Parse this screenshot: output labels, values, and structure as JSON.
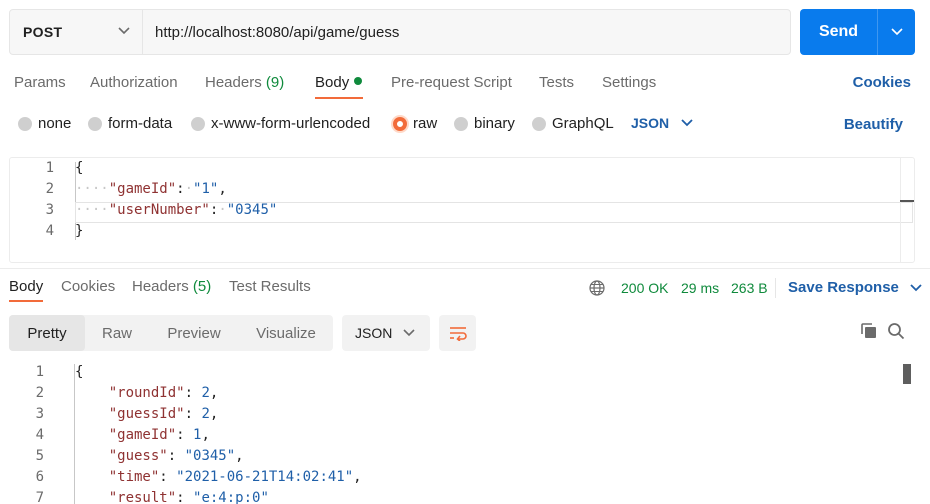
{
  "request": {
    "method": "POST",
    "url": "http://localhost:8080/api/game/guess",
    "send_label": "Send"
  },
  "request_tabs": [
    {
      "label": "Params"
    },
    {
      "label": "Authorization"
    },
    {
      "label": "Headers",
      "count": "(9)"
    },
    {
      "label": "Body"
    },
    {
      "label": "Pre-request Script"
    },
    {
      "label": "Tests"
    },
    {
      "label": "Settings"
    }
  ],
  "cookies_label": "Cookies",
  "body_types": [
    "none",
    "form-data",
    "x-www-form-urlencoded",
    "raw",
    "binary",
    "GraphQL"
  ],
  "body_format": "JSON",
  "beautify_label": "Beautify",
  "request_body": {
    "line_numbers": [
      "1",
      "2",
      "3",
      "4"
    ],
    "open_brace": "{",
    "close_brace": "}",
    "game_key": "\"gameId\"",
    "game_val": "\"1\"",
    "user_key": "\"userNumber\"",
    "user_val": "\"0345\""
  },
  "response_tabs": [
    {
      "label": "Body"
    },
    {
      "label": "Cookies"
    },
    {
      "label": "Headers",
      "count": "(5)"
    },
    {
      "label": "Test Results"
    }
  ],
  "response_status": {
    "status": "200 OK",
    "time": "29 ms",
    "size": "263 B"
  },
  "save_response_label": "Save Response",
  "view_modes": [
    "Pretty",
    "Raw",
    "Preview",
    "Visualize"
  ],
  "response_format": "JSON",
  "response_body": {
    "line_numbers": [
      "1",
      "2",
      "3",
      "4",
      "5",
      "6",
      "7"
    ],
    "open_brace": "{",
    "lines": [
      {
        "key": "\"roundId\"",
        "value": "2",
        "type": "n"
      },
      {
        "key": "\"guessId\"",
        "value": "2",
        "type": "n"
      },
      {
        "key": "\"gameId\"",
        "value": "1",
        "type": "n"
      },
      {
        "key": "\"guess\"",
        "value": "\"0345\"",
        "type": "s"
      },
      {
        "key": "\"time\"",
        "value": "\"2021-06-21T14:02:41\"",
        "type": "s"
      },
      {
        "key": "\"result\"",
        "value": "\"e:4:p:0\"",
        "type": "s"
      }
    ]
  },
  "colors": {
    "accent": "#f26b3a",
    "primary": "#097bed",
    "link": "#1f5fa8",
    "success": "#0f8a3c"
  }
}
